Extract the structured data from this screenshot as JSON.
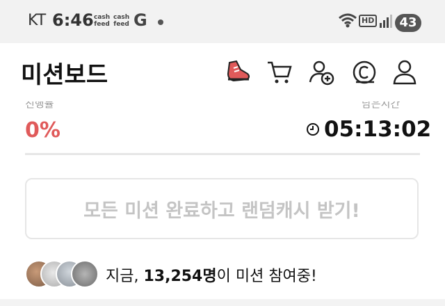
{
  "status_bar": {
    "carrier": "KT",
    "time": "6:46",
    "app_icons": [
      {
        "line1": "cash",
        "line2": "feed"
      },
      {
        "line1": "cash",
        "line2": "feed"
      }
    ],
    "g_letter": "G",
    "network_badge": "HD",
    "battery": "43"
  },
  "header": {
    "title": "미션보드",
    "icons": [
      "shoe-icon",
      "cart-icon",
      "add-friend-icon",
      "coin-icon",
      "profile-icon"
    ]
  },
  "stats": {
    "rate_label": "진행률",
    "rate_value": "0%",
    "timer_label": "남은시간",
    "timer_value": "05:13:02"
  },
  "mission": {
    "button_label": "모든 미션 완료하고 랜덤캐시 받기!"
  },
  "participants": {
    "prefix": "지금, ",
    "count": "13,254명",
    "suffix": "이 미션 참여중!"
  },
  "colors": {
    "accent_red": "#e05a5a",
    "muted_text": "#c4c4c4",
    "border": "#e6e6e6"
  }
}
